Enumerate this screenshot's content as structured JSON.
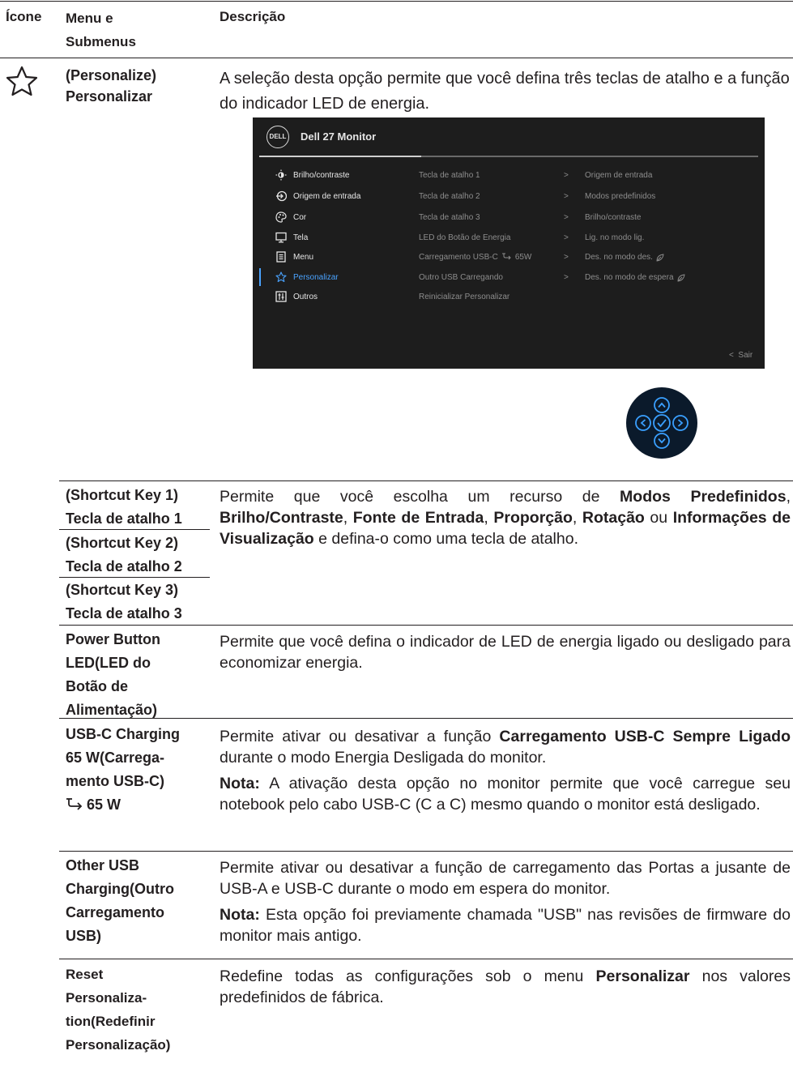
{
  "header": {
    "col_icon": "Ícone",
    "col_menu": "Menu e Submenus",
    "col_desc": "Descrição"
  },
  "personalize": {
    "menu": "(Personalize) Personalizar",
    "desc": "A seleção desta opção permite que você defina três teclas de atalho e a função do indicador LED de energia."
  },
  "osd": {
    "logo": "DELL",
    "title": "Dell 27 Monitor",
    "menu_items": [
      "Brilho/contraste",
      "Origem de entrada",
      "Cor",
      "Tela",
      "Menu",
      "Personalizar",
      "Outros"
    ],
    "options": [
      "Tecla de atalho 1",
      "Tecla de atalho 2",
      "Tecla de atalho 3",
      "LED do Botão de Energia",
      "Carregamento USB-C",
      "Outro USB Carregando",
      "Reinicializar Personalizar"
    ],
    "usbc_power": "65W",
    "values": [
      "Origem de entrada",
      "Modos predefinidos",
      "Brilho/contraste",
      "Lig. no modo lig.",
      "Des. no modo des.",
      "Des. no modo de espera"
    ],
    "arrow": ">",
    "exit": "Sair",
    "selected_color": "#4aa3ff"
  },
  "rows": {
    "sk1": "(Shortcut Key 1) Tecla de atalho 1",
    "sk2": "(Shortcut Key 2) Tecla de atalho 2",
    "sk3": "(Shortcut Key 3) Tecla de atalho 3",
    "sk_desc": {
      "t1": "Permite que você escolha um recurso de ",
      "b1": "Modos Predefinidos",
      "t2": ", ",
      "b2": "Brilho/Contraste",
      "t3": ", ",
      "b3": "Fonte de Entrada",
      "t4": ", ",
      "b4": "Proporção",
      "t5": ", ",
      "b5": "Rotação",
      "t6": " ou ",
      "b6": "Informações de Visualização",
      "t7": " e defina-o como uma tecla de atalho."
    },
    "led": "Power Button LED(LED do Botão de Alimentação)",
    "led_desc": "Permite que você defina o indicador de LED de energia ligado ou desligado para economizar energia.",
    "usbc_menu": "USB-C Charging 65 W(Carrega-mento USB-C)",
    "usbc_menu_power": "65 W",
    "usbc_desc": {
      "t1": "Permite ativar ou desativar a função ",
      "b1": "Carregamento USB-C Sempre Ligado",
      "t2": " durante o modo Energia Desligada do monitor.",
      "note_label": "Nota:",
      "note": " A ativação desta opção no monitor permite que você carregue seu notebook pelo cabo USB-C (C a C) mesmo quando o monitor está desligado."
    },
    "other": "Other USB Charging(Outro Carregamento USB)",
    "other_desc": {
      "t1": "Permite ativar ou desativar a função de carregamento das Portas a jusante de USB-A e USB-C durante o modo em espera do monitor.",
      "note_label": "Nota:",
      "note": " Esta opção foi previamente chamada \"USB\" nas revisões de firmware do monitor mais antigo."
    },
    "reset": "Reset Personaliza-tion(Redefinir Personalização)",
    "reset_desc": {
      "t1": "Redefine todas as configurações sob o menu ",
      "b1": "Personalizar",
      "t2": " nos valores predefinidos de fábrica."
    }
  }
}
